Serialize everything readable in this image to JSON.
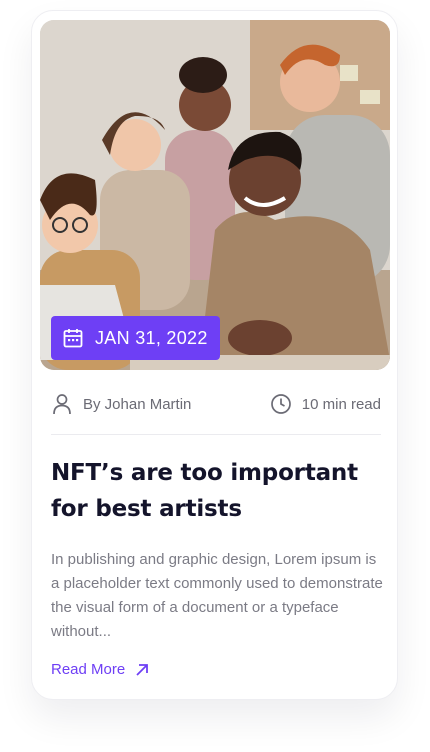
{
  "post": {
    "date": "JAN 31, 2022",
    "author": "By Johan Martin",
    "read_time": "10 min read",
    "title": "NFT’s are too important for best artists",
    "excerpt": "In publishing and graphic design, Lorem ipsum is a placeholder text commonly used to demonstrate the visual form of a document or a typeface without...",
    "read_more_label": "Read More"
  },
  "icons": {
    "date": "calendar-icon",
    "author": "user-icon",
    "read_time": "clock-icon",
    "read_more": "arrow-up-right-icon"
  },
  "colors": {
    "accent": "#6e3ff5",
    "title": "#14142b",
    "body_text": "#7b7b85",
    "meta_text": "#6b6b75"
  }
}
